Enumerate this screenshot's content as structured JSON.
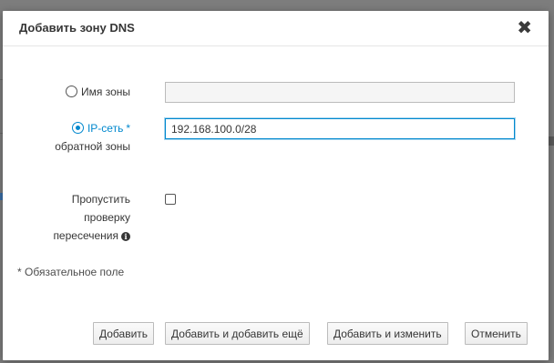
{
  "dialog": {
    "title": "Добавить зону DNS",
    "close_glyph": "✖"
  },
  "form": {
    "zone_name": {
      "label": "Имя зоны",
      "value": "",
      "selected": false
    },
    "reverse_zone": {
      "label_line1": "IP-сеть",
      "required_marker": "*",
      "label_line2": "обратной зоны",
      "value": "192.168.100.0/28",
      "selected": true
    },
    "skip_overlap_check": {
      "label_line1": "Пропустить",
      "label_line2": "проверку",
      "label_line3": "пересечения",
      "info_icon": "info-icon",
      "checked": false
    },
    "required_note": "* Обязательное поле"
  },
  "footer": {
    "add": "Добавить",
    "add_and_add_another": "Добавить и добавить ещё",
    "add_and_edit": "Добавить и изменить",
    "cancel": "Отменить"
  },
  "colors": {
    "accent": "#0088ce",
    "overlay": "#7d7d7d"
  }
}
